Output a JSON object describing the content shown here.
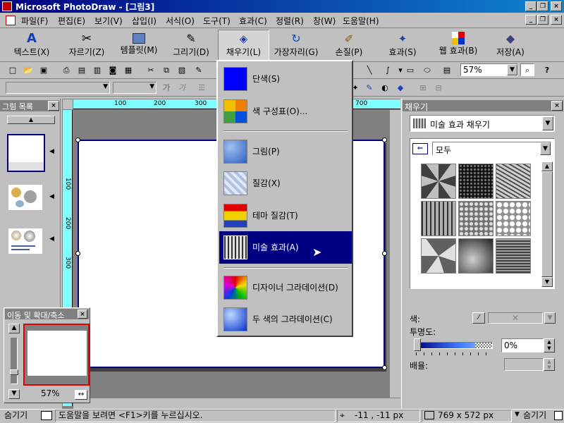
{
  "window": {
    "title": "Microsoft PhotoDraw - [그림3]"
  },
  "menu": [
    "파일(F)",
    "편집(E)",
    "보기(V)",
    "삽입(I)",
    "서식(O)",
    "도구(T)",
    "효과(C)",
    "정렬(R)",
    "창(W)",
    "도움말(H)"
  ],
  "big_tools": [
    "텍스트(X)",
    "자르기(Z)",
    "템플릿(M)",
    "그리기(D)",
    "채우기(L)",
    "가장자리(G)",
    "손질(P)",
    "효과(S)",
    "웹 효과(B)",
    "저장(A)"
  ],
  "zoom_combo": "57%",
  "fmt_glyphs": [
    "가",
    "가"
  ],
  "picture_list": {
    "title": "그림 목록"
  },
  "ruler": {
    "h_labels": [
      "100",
      "200",
      "300",
      "700"
    ],
    "v_labels": [
      "100",
      "200",
      "300"
    ]
  },
  "nav": {
    "title": "이동 및 확대/축소",
    "zoom": "57%"
  },
  "dropdown": {
    "items": [
      "단색(S)",
      "색 구성표(O)...",
      "그림(P)",
      "질감(X)",
      "테마 질감(T)",
      "미술 효과(A)",
      "디자이너 그라데이션(D)",
      "두 색의 그라데이션(C)"
    ]
  },
  "fill_panel": {
    "title": "채우기",
    "type_value": "미술 효과 채우기",
    "category_value": "모두",
    "color_label": "색:",
    "transparency_label": "투명도:",
    "transparency_value": "0%",
    "scale_label": "배율:"
  },
  "status": {
    "hide_left": "숨기기",
    "help": "도움말을 보려면 <F1>키를 누르십시오.",
    "coords": "-11 , -11 px",
    "size": "769 x 572  px",
    "hide_right": "숨기기"
  },
  "colors": {
    "title_bar": "#000080",
    "selection": "#000080",
    "ruler": "#80ffff",
    "canvas_outline": "#000080"
  }
}
